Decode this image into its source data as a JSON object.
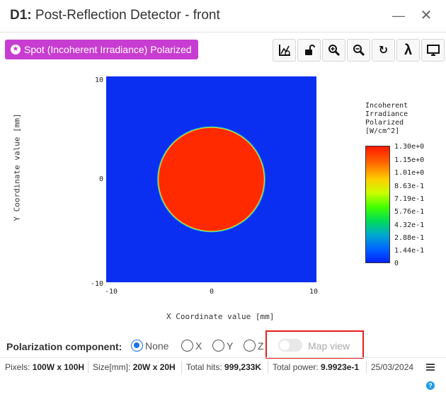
{
  "window": {
    "title_prefix": "D1:",
    "title_text": "Post-Reflection Detector - front",
    "minimize_glyph": "—",
    "close_glyph": "✕"
  },
  "analysis_badge": {
    "label": "Spot (Incoherent Irradiance) Polarized",
    "color": "#c83dd1",
    "icon": "star-circle-icon"
  },
  "toolbar": {
    "buttons": [
      {
        "name": "settings-chart-icon"
      },
      {
        "name": "unlock-icon"
      },
      {
        "name": "zoom-in-icon"
      },
      {
        "name": "zoom-out-icon"
      },
      {
        "name": "refresh-icon",
        "glyph": "↻"
      },
      {
        "name": "wavelength-icon",
        "glyph": "λ"
      },
      {
        "name": "monitor-icon"
      }
    ]
  },
  "chart_data": {
    "type": "heatmap",
    "title": "",
    "xlabel": "X Coordinate value [mm]",
    "ylabel": "Y Coordinate value [mm]",
    "xlim": [
      -10,
      10
    ],
    "ylim": [
      -10,
      10
    ],
    "x_ticks": [
      "-10",
      "0",
      "10"
    ],
    "y_ticks": [
      "10",
      "0",
      "-10"
    ],
    "spot": {
      "shape": "circle",
      "center_x": 0,
      "center_y": 0,
      "radius": 5,
      "value": 1.3
    },
    "background_value": 0,
    "colorbar": {
      "title_lines": [
        "Incoherent",
        "Irradiance",
        "Polarized",
        "[W/cm^2]"
      ],
      "labels": [
        "1.30e+0",
        "1.15e+0",
        "1.01e+0",
        "8.63e-1",
        "7.19e-1",
        "5.76e-1",
        "4.32e-1",
        "2.88e-1",
        "1.44e-1",
        "0"
      ],
      "min_color": "#0022ff",
      "max_color": "#ff1a00"
    },
    "grid": false
  },
  "polarization": {
    "label": "Polarization component:",
    "options": [
      "None",
      "X",
      "Y",
      "Z"
    ],
    "selected": "None",
    "map_view_label": "Map view",
    "map_view_enabled": false
  },
  "status": {
    "pixels_label": "Pixels:",
    "pixels_value": "100W x 100H",
    "size_label": "Size[mm]:",
    "size_value": "20W x 20H",
    "hits_label": "Total hits:",
    "hits_value": "999,233K",
    "power_label": "Total power:",
    "power_value": "9.9923e-1",
    "date": "25/03/2024"
  },
  "colors": {
    "accent": "#1a73e8",
    "highlight_box": "#e0201d",
    "heat_background": "#0a2ff0",
    "spot": "#ff2a00"
  }
}
